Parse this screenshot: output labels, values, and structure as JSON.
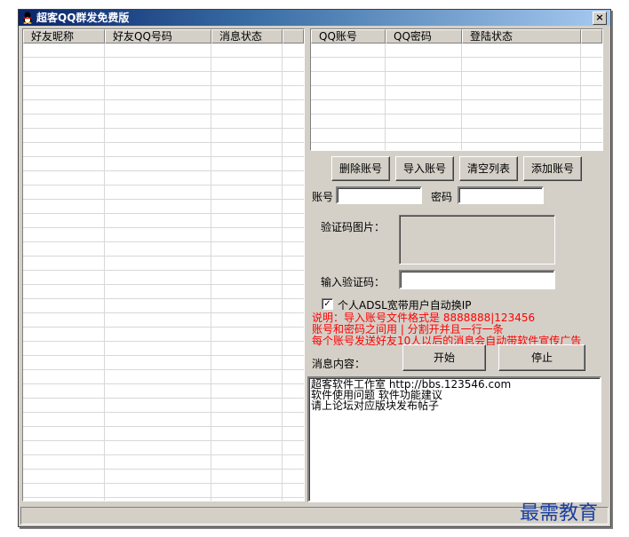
{
  "window": {
    "title": "超客QQ群发免费版",
    "close_label": "×"
  },
  "friends_table": {
    "columns": [
      "好友昵称",
      "好友QQ号码",
      "消息状态"
    ]
  },
  "accounts_table": {
    "columns": [
      "QQ账号",
      "QQ密码",
      "登陆状态"
    ]
  },
  "buttons": {
    "delete_account": "删除账号",
    "import_account": "导入账号",
    "clear_list": "清空列表",
    "add_account": "添加账号",
    "start": "开始",
    "stop": "停止"
  },
  "form": {
    "account_label": "账号",
    "password_label": "密码",
    "captcha_image_label": "验证码图片：",
    "captcha_input_label": "输入验证码：",
    "adsl_checkbox_label": "个人ADSL宽带用户自动换IP",
    "adsl_checked": true,
    "message_label": "消息内容："
  },
  "notes": [
    "说明：导入账号文件格式是 8888888|123456",
    "账号和密码之间用 | 分割开并且一行一条",
    "每个账号发送好友10人以后的消息会自动带软件宣传广告"
  ],
  "message_text": [
    "超客软件工作室 http://bbs.123546.com",
    "软件使用问题 软件功能建议",
    "请上论坛对应版块发布帖子"
  ],
  "watermark": "最需教育"
}
